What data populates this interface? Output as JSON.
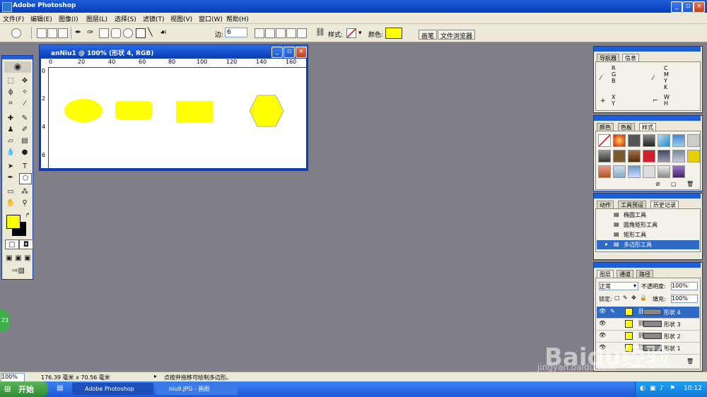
{
  "app": {
    "title": "Adobe Photoshop"
  },
  "menu": [
    "文件(F)",
    "编辑(E)",
    "图像(I)",
    "图层(L)",
    "选择(S)",
    "滤镜(T)",
    "视图(V)",
    "窗口(W)",
    "帮助(H)"
  ],
  "options": {
    "sides_label": "边:",
    "sides_value": "6",
    "style_label": "样式:",
    "color_label": "颜色:",
    "color_value": "#ffff00",
    "tab_brushes": "画笔",
    "tab_file_browser": "文件浏览器"
  },
  "document": {
    "title": "anNiu1 @ 100% (形状 4, RGB)",
    "ruler_h": [
      "0",
      "20",
      "40",
      "60",
      "80",
      "100",
      "120",
      "140",
      "160"
    ],
    "ruler_v": [
      "0",
      "2",
      "4",
      "6"
    ]
  },
  "panels": {
    "navigator": {
      "tabs": [
        "导航器",
        "信息"
      ],
      "info_rgb": "R\nG\nB",
      "info_cmyk": "C\nM\nY\nK",
      "info_xy": "X\nY",
      "info_wh": "W\nH"
    },
    "swatches": {
      "tabs": [
        "颜色",
        "色板",
        "样式"
      ]
    },
    "history": {
      "tabs": [
        "动作",
        "工具预设",
        "历史记录"
      ],
      "items": [
        "椭圆工具",
        "圆角矩形工具",
        "矩形工具",
        "多边形工具"
      ]
    },
    "layers": {
      "tabs": [
        "图层",
        "通道",
        "路径"
      ],
      "blend_mode": "正常",
      "opacity_label": "不透明度:",
      "opacity_value": "100%",
      "lock_label": "锁定:",
      "fill_label": "填充:",
      "fill_value": "100%",
      "items": [
        "形状 4",
        "形状 3",
        "形状 2",
        "形状 1"
      ]
    }
  },
  "status": {
    "zoom": "100%",
    "doc_size": "176.39 毫米 x 70.56 毫米",
    "hint": "点按并拖移可绘制多边形。"
  },
  "taskbar": {
    "start": "开始",
    "items": [
      "Adobe Photoshop",
      "niu9.JPG - 画图"
    ],
    "clock": "10:12"
  },
  "badge": "23",
  "watermark": {
    "logo": "Baidu经验",
    "url": "jingyan.baidu.com"
  },
  "colors": {
    "accent": "#0a3cb8",
    "shape_fill": "#ffff00"
  }
}
